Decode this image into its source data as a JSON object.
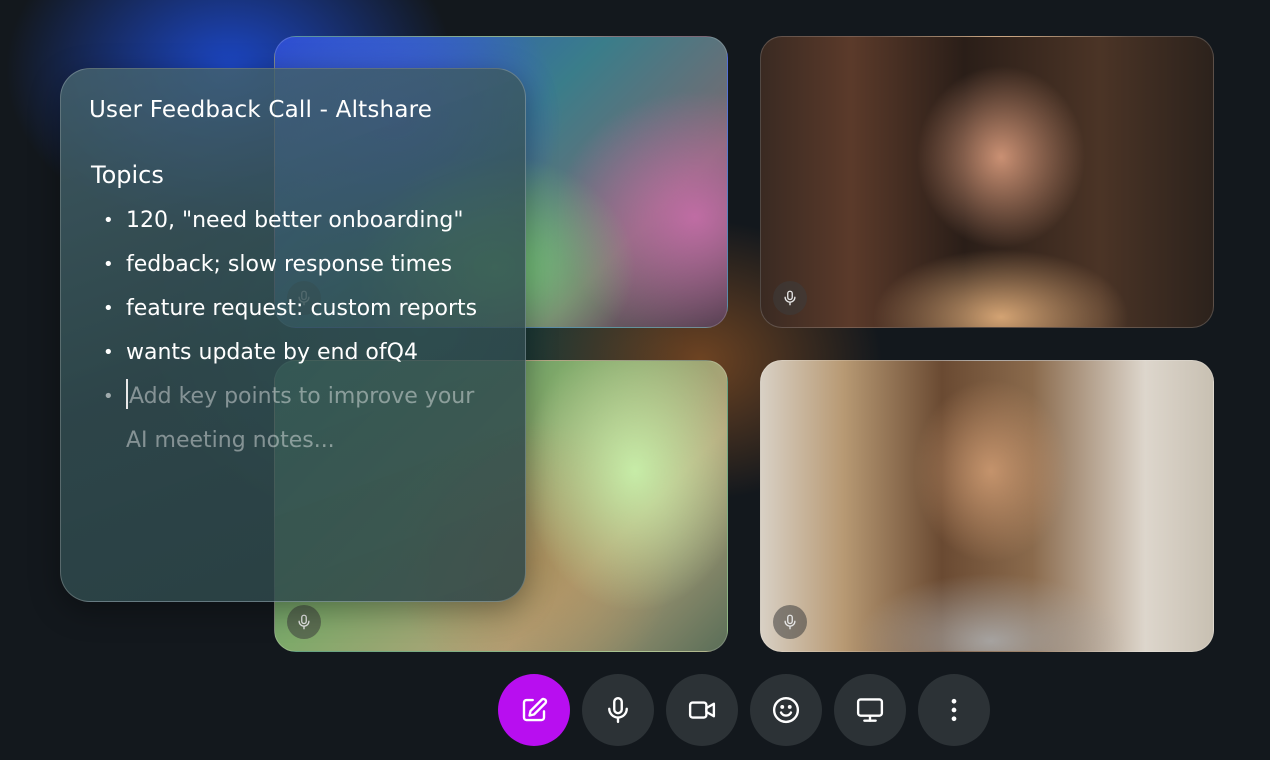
{
  "notes_panel": {
    "title": "User Feedback Call - Altshare",
    "heading": "Topics",
    "items": [
      "120, \"need better onboarding\"",
      "fedback; slow response times",
      "feature request: custom reports",
      "wants update   by end ofQ4"
    ],
    "input_placeholder": "Add key points to improve your AI meeting notes..."
  },
  "participants": [
    {
      "mic_icon": "mic-icon"
    },
    {
      "mic_icon": "mic-icon"
    },
    {
      "mic_icon": "mic-icon"
    },
    {
      "mic_icon": "mic-icon"
    }
  ],
  "controls": [
    {
      "icon": "edit-notes-icon",
      "active": true
    },
    {
      "icon": "microphone-icon",
      "active": false
    },
    {
      "icon": "camera-icon",
      "active": false
    },
    {
      "icon": "emoji-icon",
      "active": false
    },
    {
      "icon": "screen-share-icon",
      "active": false
    },
    {
      "icon": "more-vertical-icon",
      "active": false
    }
  ],
  "colors": {
    "accent": "#b80ef0",
    "control_bg": "#2c3236",
    "background": "#13181d"
  }
}
